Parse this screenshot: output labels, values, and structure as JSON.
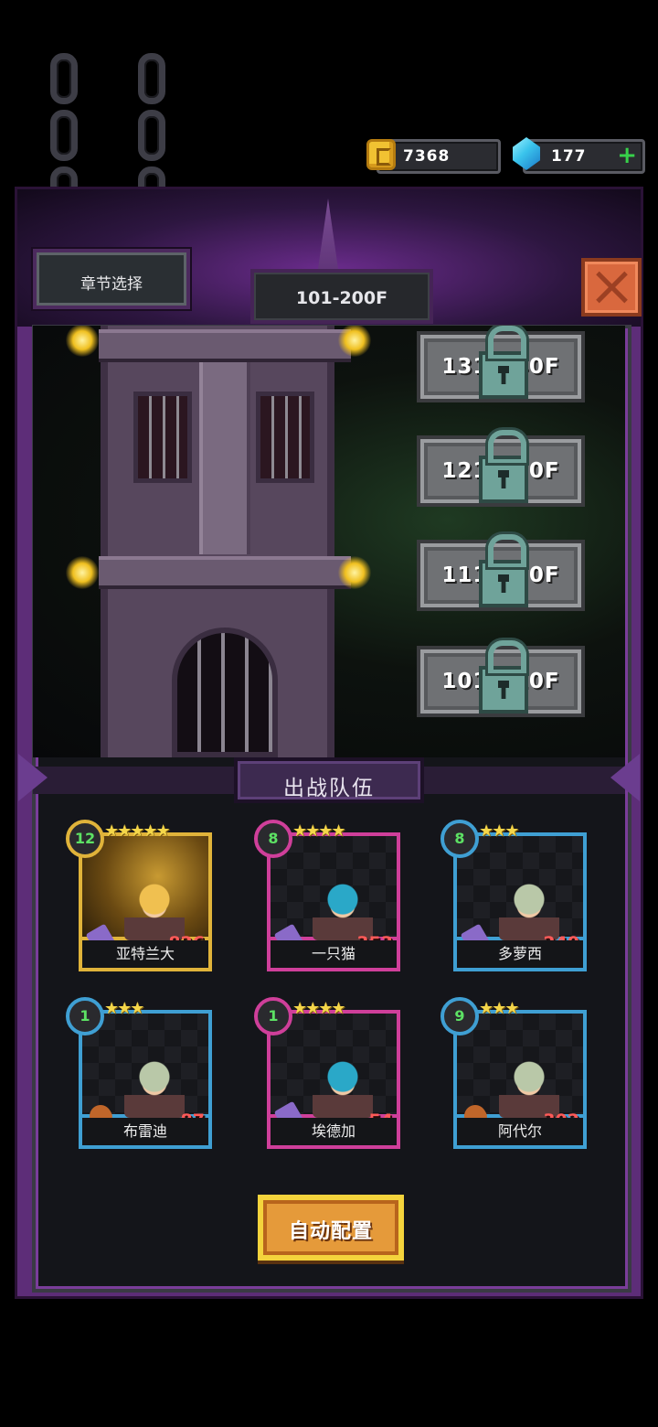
{
  "currency": {
    "coins": "7368",
    "gems": "177",
    "plus": "+"
  },
  "header": {
    "chapter_select": "章节选择",
    "floor_range": "101-200F"
  },
  "floors": [
    {
      "label": "131-140F",
      "locked": true
    },
    {
      "label": "121-130F",
      "locked": true
    },
    {
      "label": "111-120F",
      "locked": true
    },
    {
      "label": "101-110F",
      "locked": true
    }
  ],
  "team": {
    "title": "出战队伍",
    "heroes": [
      {
        "name": "亚特兰大",
        "level": "12",
        "stars": "★★★★★",
        "power": "826",
        "rarity": "gold",
        "weapon_icon": "crossbow-icon"
      },
      {
        "name": "一只猫",
        "level": "8",
        "stars": "★★★★",
        "power": "353",
        "rarity": "pink",
        "weapon_icon": "bow-icon"
      },
      {
        "name": "多萝西",
        "level": "8",
        "stars": "★★★",
        "power": "240",
        "rarity": "blue",
        "weapon_icon": "magic-swirl-icon"
      },
      {
        "name": "布雷迪",
        "level": "1",
        "stars": "★★★",
        "power": "87",
        "rarity": "blue",
        "weapon_icon": "meat-icon"
      },
      {
        "name": "埃德加",
        "level": "1",
        "stars": "★★★★",
        "power": "54",
        "rarity": "pink",
        "weapon_icon": "axe-icon"
      },
      {
        "name": "阿代尔",
        "level": "9",
        "stars": "★★★",
        "power": "302",
        "rarity": "blue",
        "weapon_icon": "meat-icon"
      }
    ]
  },
  "auto_config": "自动配置",
  "colors": {
    "frame_purple": "#5d2d78",
    "gold_border": "#e0b33a",
    "pink_border": "#cf3f9a",
    "blue_border": "#3f9fd3",
    "power_red": "#ff5a58",
    "level_green": "#5de264"
  }
}
